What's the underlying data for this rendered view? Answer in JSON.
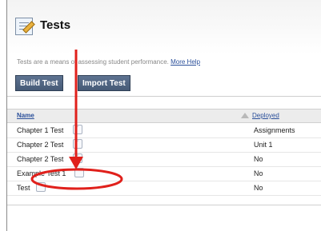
{
  "page": {
    "title": "Tests",
    "description": "Tests are a means of assessing student performance.",
    "help_link": "More Help"
  },
  "toolbar": {
    "build_label": "Build Test",
    "import_label": "Import Test"
  },
  "table": {
    "columns": [
      "Name",
      "Deployed"
    ],
    "rows": [
      {
        "name": "Chapter 1 Test",
        "deployed": "Assignments"
      },
      {
        "name": "Chapter 2 Test",
        "deployed": "Unit 1"
      },
      {
        "name": "Chapter 2 Test",
        "deployed": "No"
      },
      {
        "name": "Example Test 1",
        "deployed": "No"
      },
      {
        "name": "Test",
        "deployed": "No"
      }
    ]
  },
  "colors": {
    "annotation": "#e0201b",
    "button": "#52667f",
    "link": "#2a4f9a"
  },
  "icons": {
    "title": "test-icon",
    "row_menu": "chevron-down-icon",
    "sort": "sort-arrow-icon"
  }
}
